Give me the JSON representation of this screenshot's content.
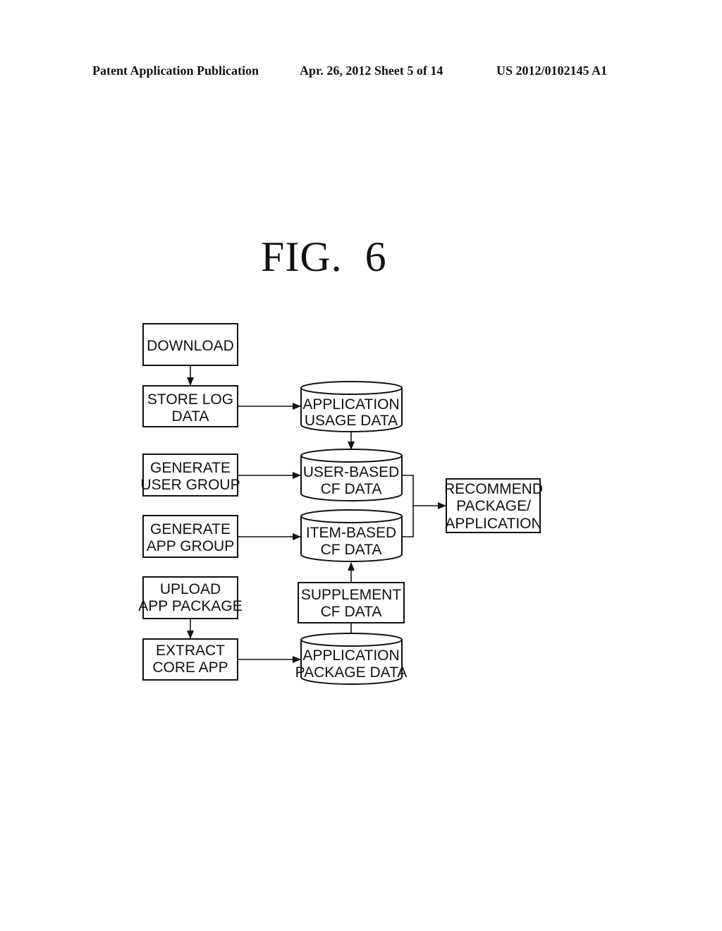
{
  "header": {
    "left": "Patent Application Publication",
    "middle": "Apr. 26, 2012  Sheet 5 of 14",
    "right": "US 2012/0102145 A1"
  },
  "figure": {
    "title": "FIG.  6"
  },
  "nodes": {
    "download": [
      "DOWNLOAD"
    ],
    "store_log": [
      "STORE LOG",
      "DATA"
    ],
    "gen_user_group": [
      "GENERATE",
      "USER GROUP"
    ],
    "gen_app_group": [
      "GENERATE",
      "APP GROUP"
    ],
    "upload_pkg": [
      "UPLOAD",
      "APP PACKAGE"
    ],
    "extract_core": [
      "EXTRACT",
      "CORE APP"
    ],
    "app_usage_db": [
      "APPLICATION",
      "USAGE DATA"
    ],
    "user_cf_db": [
      "USER-BASED",
      "CF DATA"
    ],
    "item_cf_db": [
      "ITEM-BASED",
      "CF DATA"
    ],
    "supplement_cf": [
      "SUPPLEMENT",
      "CF DATA"
    ],
    "app_pkg_db": [
      "APPLICATION",
      "PACKAGE DATA"
    ],
    "recommend": [
      "RECOMMEND",
      "PACKAGE/",
      "APPLICATION"
    ]
  },
  "edges": [
    [
      "download",
      "store_log"
    ],
    [
      "store_log",
      "app_usage_db"
    ],
    [
      "app_usage_db",
      "user_cf_db"
    ],
    [
      "gen_user_group",
      "user_cf_db"
    ],
    [
      "gen_app_group",
      "item_cf_db"
    ],
    [
      "user_cf_db",
      "recommend"
    ],
    [
      "item_cf_db",
      "recommend"
    ],
    [
      "upload_pkg",
      "extract_core"
    ],
    [
      "extract_core",
      "app_pkg_db"
    ],
    [
      "app_pkg_db",
      "supplement_cf"
    ],
    [
      "supplement_cf",
      "item_cf_db"
    ]
  ]
}
